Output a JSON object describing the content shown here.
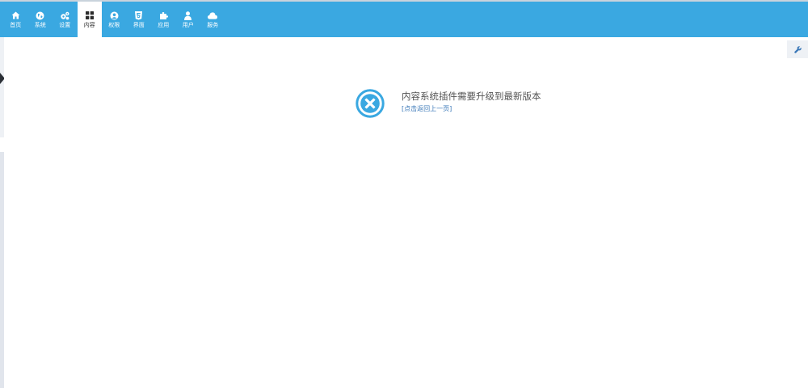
{
  "topnav": {
    "items": [
      {
        "label": "首页",
        "icon": "home-icon"
      },
      {
        "label": "系统",
        "icon": "globe-icon"
      },
      {
        "label": "设置",
        "icon": "gears-icon"
      },
      {
        "label": "内容",
        "icon": "grid-icon",
        "active": true
      },
      {
        "label": "权限",
        "icon": "user-circle-icon"
      },
      {
        "label": "界面",
        "icon": "html5-icon"
      },
      {
        "label": "应用",
        "icon": "puzzle-icon"
      },
      {
        "label": "用户",
        "icon": "user-icon"
      },
      {
        "label": "服务",
        "icon": "cloud-icon"
      }
    ],
    "colors": {
      "bar": "#3aa8e1",
      "active_bg": "#ffffff"
    }
  },
  "message": {
    "title": "内容系统插件需要升级到最新版本",
    "back_link": "[点击返回上一页]",
    "icon": "error-circle-x-icon",
    "icon_color": "#3aa8e1"
  },
  "toolbar": {
    "icon": "wrench-icon"
  }
}
